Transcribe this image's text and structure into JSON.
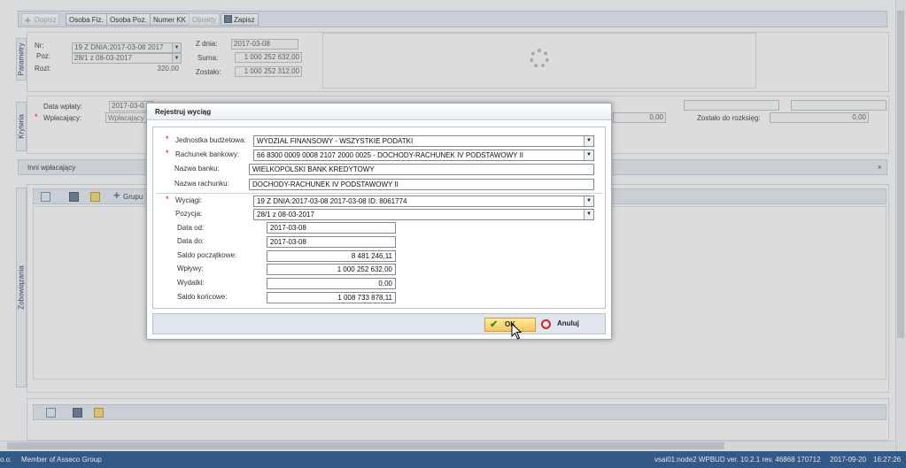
{
  "toolbar": {
    "add_label": "Dopisz",
    "osoba_fiz_label": "Osoba Fiz.",
    "osoba_poz_label": "Osoba Poz.",
    "numer_kk_label": "Numer KK",
    "obiekty_label": "Obiekty",
    "zapisz_label": "Zapisz"
  },
  "parametry": {
    "tab_label": "Parametry",
    "nr_label": "Nr:",
    "nr_value": "19 Z DNIA:2017-03-08 2017",
    "poz_label": "Poz:",
    "poz_value": "28/1 z 08-03-2017",
    "rozl_label": "Rozl:",
    "rozl_value": "320,00",
    "z_dnia_label": "Z dnia:",
    "z_dnia_value": "2017-03-08",
    "suma_label": "Suma:",
    "suma_value": "1 000 252 632,00",
    "zostalo_label": "Zostało:",
    "zostalo_value": "1 000 252 312,00"
  },
  "kryteria": {
    "tab_label": "Kryteria",
    "data_wplaty_label": "Data wpłaty:",
    "data_wplaty_value": "2017-03-0",
    "wplacajacy_label": "Wpłacający:",
    "wplacajacy_placeholder": "Wpłacający",
    "amount_value": "0,00",
    "zostalo_do_rozksieg_label": "Zostało do rozksięg:",
    "zostalo_do_rozksieg_value": "0,00"
  },
  "inni": {
    "label": "Inni wpłacający",
    "expand": "»"
  },
  "zobowiazania": {
    "tab_label": "Zobowiązania",
    "group_label": "Grupu"
  },
  "dialog": {
    "title": "Rejestruj wyciąg",
    "jednostka_label": "Jednostka budżetowa:",
    "jednostka_value": "WYDZIAŁ FINANSOWY - WSZYSTKIE PODATKI",
    "rachunek_label": "Rachunek bankowy:",
    "rachunek_value": "66 8300 0009 0008 2107 2000 0025 - DOCHODY-RACHUNEK IV PODSTAWOWY II",
    "nazwa_banku_label": "Nazwa banku:",
    "nazwa_banku_value": "WIELKOPOLSKI BANK KREDYTOWY",
    "nazwa_rachunku_label": "Nazwa rachunku:",
    "nazwa_rachunku_value": "DOCHODY-RACHUNEK IV PODSTAWOWY II",
    "wyciagi_label": "Wyciągi:",
    "wyciagi_value": "19 Z DNIA:2017-03-08 2017-03-08 ID: 8061774",
    "pozycja_label": "Pozycja:",
    "pozycja_value": "28/1 z 08-03-2017",
    "data_od_label": "Data od:",
    "data_od_value": "2017-03-08",
    "data_do_label": "Data do:",
    "data_do_value": "2017-03-08",
    "saldo_pocz_label": "Saldo początkowe:",
    "saldo_pocz_value": "8 481 246,11",
    "wplywy_label": "Wpływy:",
    "wplywy_value": "1 000 252 632,00",
    "wydatki_label": "Wydatki:",
    "wydatki_value": "0,00",
    "saldo_konc_label": "Saldo końcowe:",
    "saldo_konc_value": "1 008 733 878,11",
    "ok_label": "OK",
    "cancel_label": "Anuluj"
  },
  "status": {
    "left_fragment": "o.o.",
    "company": "Member of Asseco Group",
    "version": "vsai01:node2 WPBUD ver. 10.2.1 rev. 46868 170712",
    "date": "2017-09-20",
    "time": "16:27:26"
  },
  "colors": {
    "status_bar": "#1d4f8a",
    "ok_button": "#f8c85a",
    "required": "#dd0000"
  }
}
